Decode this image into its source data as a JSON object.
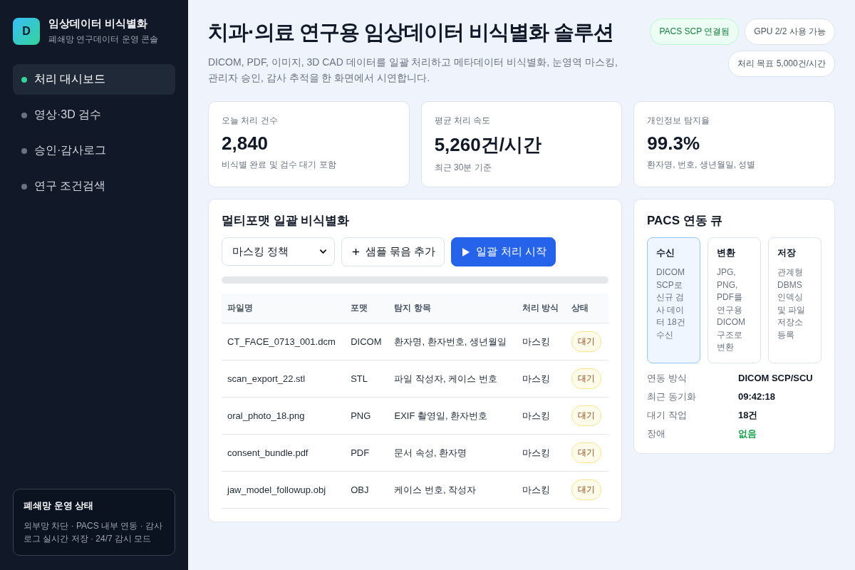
{
  "sidebar": {
    "logo": "D",
    "title": "임상데이터 비식별화",
    "subtitle": "폐쇄망 연구데이터 운영 콘솔",
    "items": [
      {
        "label": "처리 대시보드",
        "selected": true
      },
      {
        "label": "영상·3D 검수",
        "selected": false
      },
      {
        "label": "승인·감사로그",
        "selected": false
      },
      {
        "label": "연구 조건검색",
        "selected": false
      }
    ],
    "status_card": {
      "title": "폐쇄망 운영 상태",
      "text": "외부망 차단 · PACS 내부 연동 · 감사로그 실시간 저장 · 24/7 감시 모드"
    }
  },
  "header": {
    "title": "치과·의료 연구용 임상데이터 비식별화 솔루션",
    "description": "DICOM, PDF, 이미지, 3D CAD 데이터를 일괄 처리하고 메타데이터 비식별화, 눈영역 마스킹, 관리자 승인, 감사 추적을 한 화면에서 시연합니다.",
    "badges": [
      {
        "label": "PACS SCP 연결됨",
        "kind": "success"
      },
      {
        "label": "GPU 2/2 사용 가능",
        "kind": "neutral"
      },
      {
        "label": "처리 목표 5,000건/시간",
        "kind": "neutral"
      }
    ]
  },
  "stats": [
    {
      "label": "오늘 처리 건수",
      "value": "2,840",
      "note": "비식별 완료 및 검수 대기 포함"
    },
    {
      "label": "평균 처리 속도",
      "value": "5,260건/시간",
      "note": "최근 30분 기준"
    },
    {
      "label": "개인정보 탐지율",
      "value": "99.3%",
      "note": "환자명, 번호, 생년월일, 성별"
    }
  ],
  "batch": {
    "title": "멀티포맷 일괄 비식별화",
    "policy_select": "마스킹 정책",
    "add_button": "샘플 묶음 추가",
    "start_button": "일괄 처리 시작",
    "progress": {
      "level": 0
    },
    "table": {
      "columns": [
        "파일명",
        "포맷",
        "탐지 항목",
        "처리 방식",
        "상태"
      ],
      "rows": [
        [
          "CT_FACE_0713_001.dcm",
          "DICOM",
          "환자명, 환자번호, 생년월일",
          "마스킹",
          "대기"
        ],
        [
          "scan_export_22.stl",
          "STL",
          "파일 작성자, 케이스 번호",
          "마스킹",
          "대기"
        ],
        [
          "oral_photo_18.png",
          "PNG",
          "EXIF 촬영일, 환자번호",
          "마스킹",
          "대기"
        ],
        [
          "consent_bundle.pdf",
          "PDF",
          "문서 속성, 환자명",
          "마스킹",
          "대기"
        ],
        [
          "jaw_model_followup.obj",
          "OBJ",
          "케이스 번호, 작성자",
          "마스킹",
          "대기"
        ]
      ]
    }
  },
  "pacs": {
    "title": "PACS 연동 큐",
    "stages": [
      {
        "title": "수신",
        "text": "DICOM SCP로 신규 검사 데이터 18건 수신",
        "selected": true
      },
      {
        "title": "변환",
        "text": "JPG, PNG, PDF를 연구용 DICOM 구조로 변환",
        "selected": false
      },
      {
        "title": "저장",
        "text": "관계형 DBMS 인덱싱 및 파일 저장소 등록",
        "selected": false
      }
    ],
    "details": [
      {
        "label": "연동 방식",
        "value": "DICOM SCP/SCU",
        "kind": "normal"
      },
      {
        "label": "최근 동기화",
        "value": "09:42:18",
        "kind": "normal"
      },
      {
        "label": "대기 작업",
        "value": "18건",
        "kind": "normal"
      },
      {
        "label": "장애",
        "value": "없음",
        "kind": "success"
      }
    ]
  }
}
